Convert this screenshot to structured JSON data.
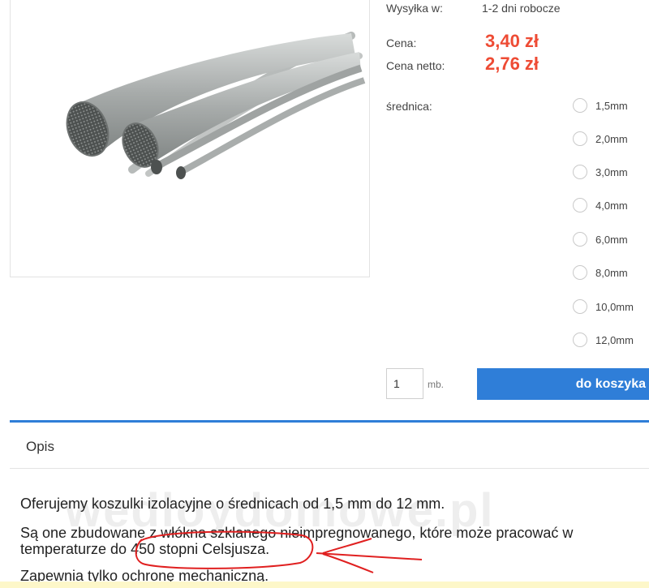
{
  "product": {
    "image_icon": "fiberglass-sleeves-photo",
    "shipping_label": "Wysyłka w:",
    "shipping_value": "1-2 dni robocze",
    "price_label": "Cena:",
    "price_value": "3,40 zł",
    "net_label": "Cena netto:",
    "net_value": "2,76 zł",
    "price_color": "#ee4b34",
    "diameter_label": "średnica:",
    "diameter_options": [
      "1,5mm",
      "2,0mm",
      "3,0mm",
      "4,0mm",
      "6,0mm",
      "8,0mm",
      "10,0mm",
      "12,0mm"
    ]
  },
  "cart": {
    "quantity": "1",
    "unit": "mb.",
    "button_label": "do koszyka",
    "accent_color": "#2f7ed8"
  },
  "tabs": {
    "description_label": "Opis"
  },
  "description": {
    "paragraph1": "Oferujemy koszulki izolacyjne o średnicach od 1,5 mm do 12 mm.",
    "paragraph2_line1": "Są one zbudowane z włókna szklanego nieimpregnowanego, które może pracować w",
    "paragraph2_line2": "temperaturze do 450 stopni Celsjusza.",
    "paragraph3": "Zapewnia tylko ochronę mechaniczną."
  },
  "watermark": "wedloydomowe.pl",
  "annotation_color": "#e02020"
}
